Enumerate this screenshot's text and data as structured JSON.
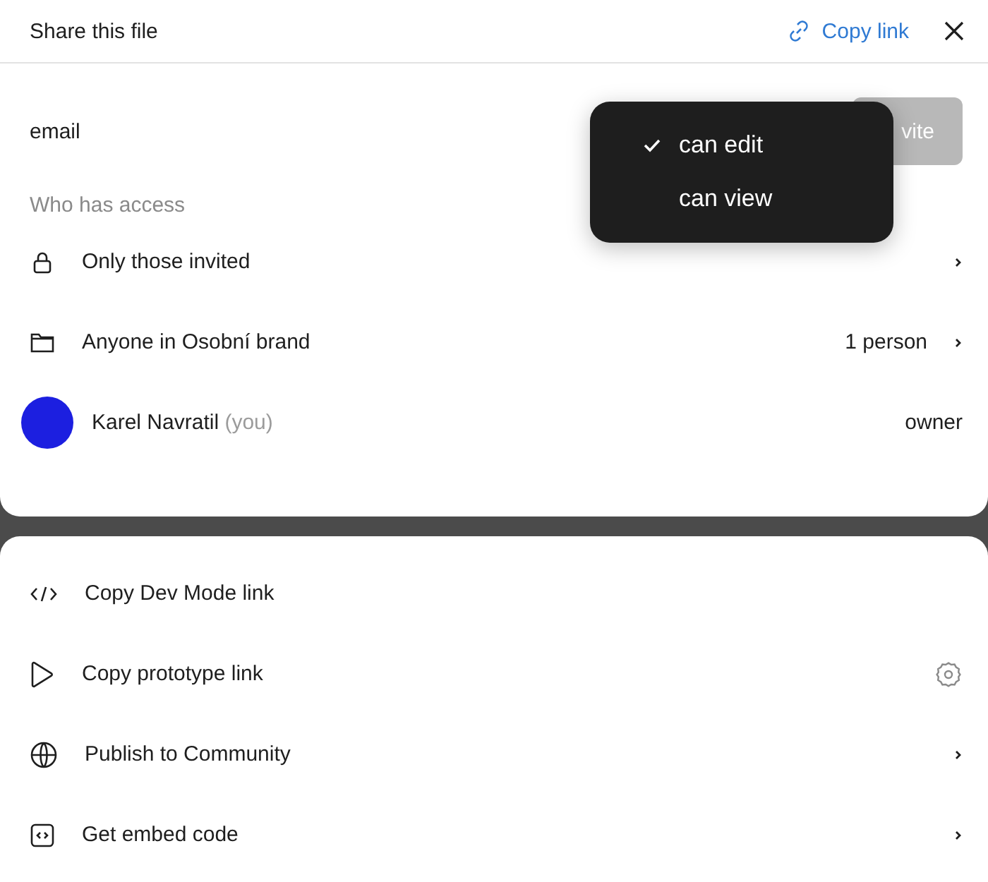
{
  "header": {
    "title": "Share this file",
    "copy_link": "Copy link"
  },
  "invite": {
    "value": "email",
    "button": "vite"
  },
  "permission_menu": [
    {
      "label": "can edit",
      "selected": true
    },
    {
      "label": "can view",
      "selected": false
    }
  ],
  "access": {
    "heading": "Who has access",
    "rows": [
      {
        "kind": "lock",
        "label": "Only those invited",
        "chevron": true
      },
      {
        "kind": "folder",
        "label": "Anyone in Osobní brand",
        "value": "1 person",
        "chevron": true
      },
      {
        "kind": "avatar",
        "label": "Karel Navratil",
        "note": "(you)",
        "value": "owner",
        "chevron": false
      }
    ]
  },
  "actions": [
    {
      "kind": "code",
      "label": "Copy Dev Mode link",
      "settings": false,
      "chevron": false
    },
    {
      "kind": "play",
      "label": "Copy prototype link",
      "settings": true,
      "chevron": false
    },
    {
      "kind": "globe",
      "label": "Publish to Community",
      "settings": false,
      "chevron": true
    },
    {
      "kind": "embed",
      "label": "Get embed code",
      "settings": false,
      "chevron": true
    }
  ]
}
